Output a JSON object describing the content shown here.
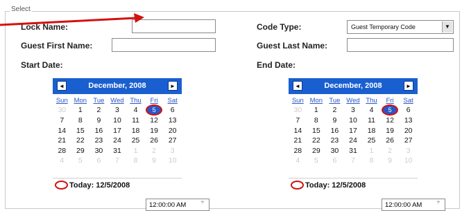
{
  "group": {
    "legend": "Select"
  },
  "fields": {
    "lock_name_label": "Lock Name:",
    "guest_first_label": "Guest First Name:",
    "start_date_label": "Start Date:",
    "code_type_label": "Code Type:",
    "code_type_value": "Guest Temporary Code",
    "guest_last_label": "Guest Last Name:",
    "end_date_label": "End Date:"
  },
  "calendar": {
    "month_title": "December, 2008",
    "prev": "◄",
    "next": "►",
    "weekdays": [
      "Sun",
      "Mon",
      "Tue",
      "Wed",
      "Thu",
      "Fri",
      "Sat"
    ],
    "weeks": [
      [
        "30",
        "1",
        "2",
        "3",
        "4",
        "5",
        "6"
      ],
      [
        "7",
        "8",
        "9",
        "10",
        "11",
        "12",
        "13"
      ],
      [
        "14",
        "15",
        "16",
        "17",
        "18",
        "19",
        "20"
      ],
      [
        "21",
        "22",
        "23",
        "24",
        "25",
        "26",
        "27"
      ],
      [
        "28",
        "29",
        "30",
        "31",
        "1",
        "2",
        "3"
      ],
      [
        "4",
        "5",
        "6",
        "7",
        "8",
        "9",
        "10"
      ]
    ],
    "selected_day": "5",
    "today_text": "Today: 12/5/2008"
  },
  "start_time": "12:00:00 AM",
  "end_time": "12:00:00 AM",
  "spin_glyph": "÷",
  "colors": {
    "accent": "#1a5fd0",
    "highlight": "#d21111"
  }
}
